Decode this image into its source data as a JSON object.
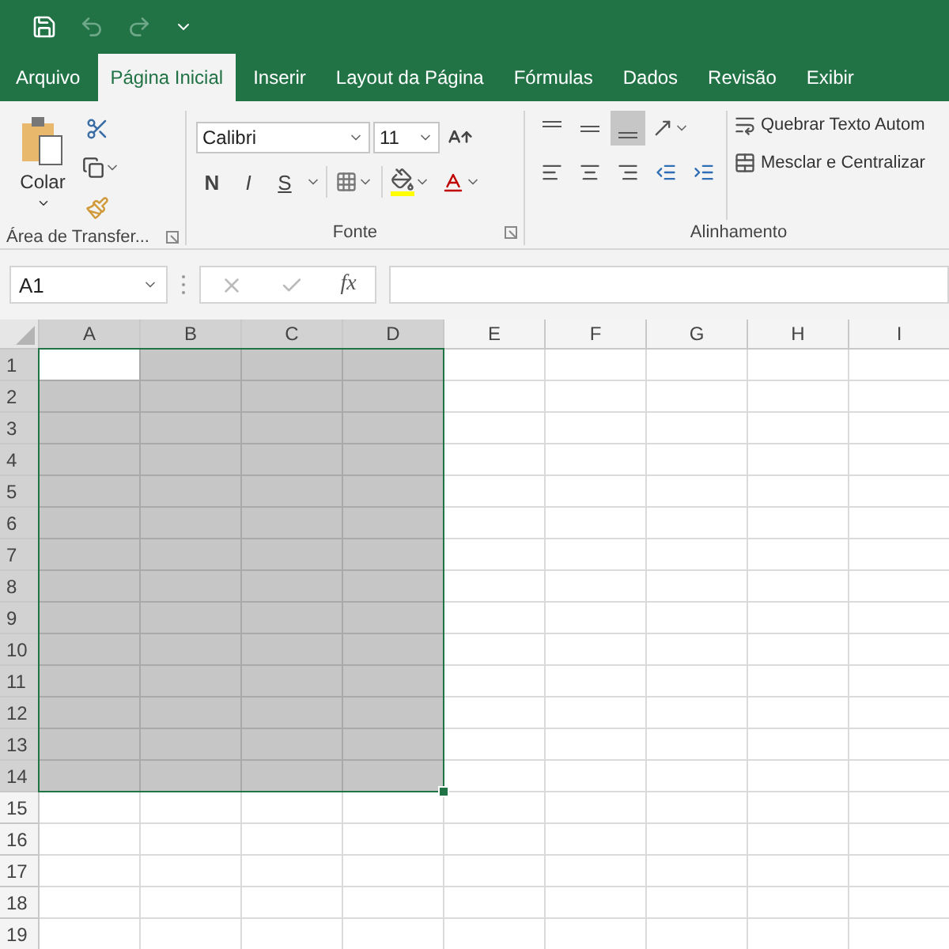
{
  "tabs": [
    {
      "label": "Arquivo",
      "selected": false
    },
    {
      "label": "Página Inicial",
      "selected": true
    },
    {
      "label": "Inserir",
      "selected": false
    },
    {
      "label": "Layout da Página",
      "selected": false
    },
    {
      "label": "Fórmulas",
      "selected": false
    },
    {
      "label": "Dados",
      "selected": false
    },
    {
      "label": "Revisão",
      "selected": false
    },
    {
      "label": "Exibir",
      "selected": false
    }
  ],
  "clipboard": {
    "paste_label": "Colar",
    "group_label": "Área de Transfer..."
  },
  "font": {
    "font_name": "Calibri",
    "font_size": "11",
    "style_buttons": [
      "N",
      "I",
      "S"
    ],
    "group_label": "Fonte"
  },
  "alignment": {
    "vertical_buttons": [
      {
        "kind": "top",
        "selected": false
      },
      {
        "kind": "middle",
        "selected": false
      },
      {
        "kind": "bottom",
        "selected": true
      }
    ],
    "wrap_text": "Quebrar Texto Autom",
    "merge": "Mesclar e Centralizar",
    "group_label": "Alinhamento"
  },
  "formula_bar": {
    "name_box": "A1",
    "function_label": "fx"
  },
  "sheet": {
    "columns": [
      {
        "label": "A",
        "selected": true,
        "active": true
      },
      {
        "label": "B",
        "selected": true,
        "active": false
      },
      {
        "label": "C",
        "selected": true,
        "active": false
      },
      {
        "label": "D",
        "selected": true,
        "active": false
      },
      {
        "label": "E",
        "selected": false,
        "active": false
      },
      {
        "label": "F",
        "selected": false,
        "active": false
      },
      {
        "label": "G",
        "selected": false,
        "active": false
      },
      {
        "label": "H",
        "selected": false,
        "active": false
      },
      {
        "label": "I",
        "selected": false,
        "active": false
      }
    ],
    "rows": [
      {
        "label": "1",
        "selected": true,
        "active": true
      },
      {
        "label": "2",
        "selected": true,
        "active": false
      },
      {
        "label": "3",
        "selected": true,
        "active": false
      },
      {
        "label": "4",
        "selected": true,
        "active": false
      },
      {
        "label": "5",
        "selected": true,
        "active": false
      },
      {
        "label": "6",
        "selected": true,
        "active": false
      },
      {
        "label": "7",
        "selected": true,
        "active": false
      },
      {
        "label": "8",
        "selected": true,
        "active": false
      },
      {
        "label": "9",
        "selected": true,
        "active": false
      },
      {
        "label": "10",
        "selected": true,
        "active": false
      },
      {
        "label": "11",
        "selected": true,
        "active": false
      },
      {
        "label": "12",
        "selected": true,
        "active": false
      },
      {
        "label": "13",
        "selected": true,
        "active": false
      },
      {
        "label": "14",
        "selected": true,
        "active": false
      },
      {
        "label": "15",
        "selected": false,
        "active": false
      },
      {
        "label": "16",
        "selected": false,
        "active": false
      },
      {
        "label": "17",
        "selected": false,
        "active": false
      },
      {
        "label": "18",
        "selected": false,
        "active": false
      },
      {
        "label": "19",
        "selected": false,
        "active": false
      }
    ]
  }
}
